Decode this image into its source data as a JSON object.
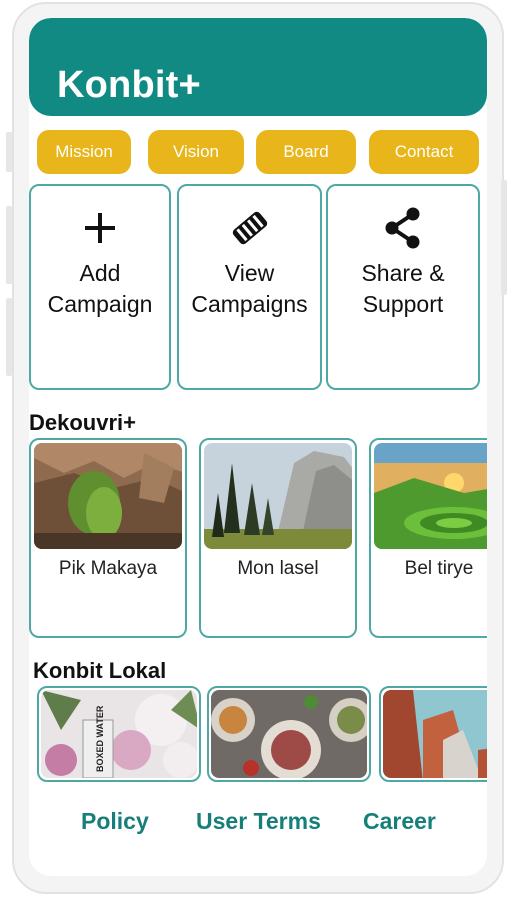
{
  "app": {
    "title": "Konbit+"
  },
  "chips": [
    "Mission",
    "Vision",
    "Board",
    "Contact"
  ],
  "actions": [
    {
      "icon": "plus-icon",
      "label": "Add\nCampaign"
    },
    {
      "icon": "handshake-icon",
      "label": "View\nCampaigns"
    },
    {
      "icon": "share-icon",
      "label": "Share &\nSupport"
    }
  ],
  "dekouvri": {
    "title": "Dekouvri+",
    "items": [
      {
        "label": "Pik Makaya",
        "image": "mossy-rock-cliff-photo"
      },
      {
        "label": "Mon lasel",
        "image": "valley-granite-cliff-photo"
      },
      {
        "label": "Bel tirye",
        "image": "green-hills-sunset-photo"
      }
    ]
  },
  "lokal": {
    "title": "Konbit Lokal",
    "items": [
      {
        "image": "flowers-boxed-water-photo",
        "text": "BOXED WATER"
      },
      {
        "image": "food-plates-photo"
      },
      {
        "image": "red-rock-canyon-photo"
      }
    ]
  },
  "footer": {
    "links": [
      "Policy",
      "User Terms",
      "Career"
    ]
  },
  "colors": {
    "header": "#128a84",
    "chip": "#e8b51a",
    "card_border": "#4fa8a4",
    "footer_link": "#177f79"
  }
}
